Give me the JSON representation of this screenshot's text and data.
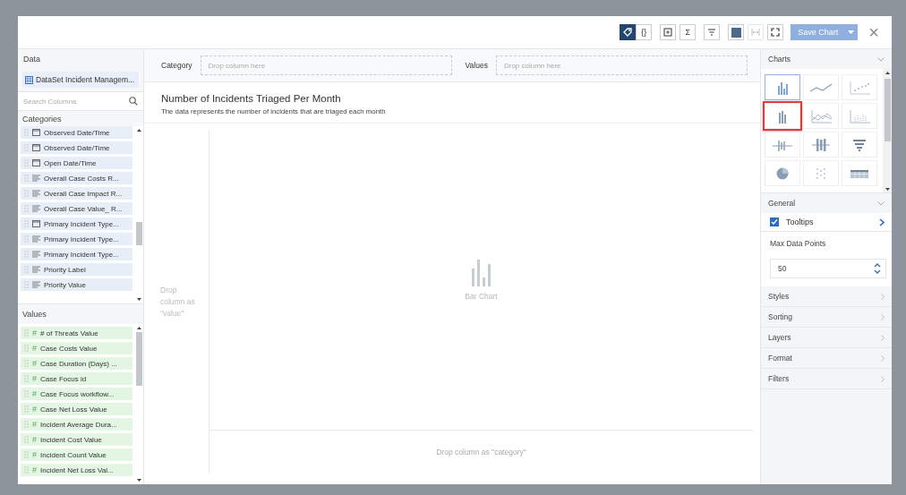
{
  "toolbar": {
    "buttons": [
      {
        "kind": "tag",
        "selected": true
      },
      {
        "kind": "braces",
        "label": "{}",
        "selected": false
      },
      {
        "kind": "frame",
        "selected": false
      },
      {
        "kind": "sigma",
        "label": "Σ",
        "selected": false
      },
      {
        "kind": "filter",
        "selected": false
      },
      {
        "kind": "swatch",
        "selected": false
      },
      {
        "kind": "width",
        "selected": false,
        "disabled": true
      },
      {
        "kind": "expand",
        "selected": false
      }
    ],
    "save": {
      "label": "Save Chart",
      "disabled": true
    },
    "close": "×"
  },
  "data_panel": {
    "title": "Data",
    "dataset": "DataSet Incident Managem...",
    "search": {
      "placeholder": "Search Columns"
    },
    "categories_title": "Categories",
    "categories": [
      {
        "kind": "date",
        "label": "Observed Date/Time"
      },
      {
        "kind": "date",
        "label": "Observed Date/Time"
      },
      {
        "kind": "date",
        "label": "Open Date/Time"
      },
      {
        "kind": "text",
        "label": "Overall Case Costs R..."
      },
      {
        "kind": "text",
        "label": "Overall Case Impact R..."
      },
      {
        "kind": "text",
        "label": "Overall Case Value_ R..."
      },
      {
        "kind": "date",
        "label": "Primary Incident Type..."
      },
      {
        "kind": "text",
        "label": "Primary Incident Type..."
      },
      {
        "kind": "text",
        "label": "Primary Incident Type..."
      },
      {
        "kind": "text",
        "label": "Priority Label"
      },
      {
        "kind": "text",
        "label": "Priority Value"
      }
    ],
    "values_title": "Values",
    "number_mark": "#",
    "values": [
      "# of Threats Value",
      "Case Costs Value",
      "Case Duration (Days) ...",
      "Case Focus id",
      "Case Focus workflow...",
      "Case Net Loss Value",
      "Incident Average Dura...",
      "Incident Cost Value",
      "Incident Count Value",
      "Incident Net Loss Val..."
    ]
  },
  "drop_bar": {
    "category_label": "Category",
    "category_placeholder": "Drop column here",
    "values_label": "Values",
    "values_placeholder": "Drop column here"
  },
  "chart": {
    "title": "Number of Incidents Triaged Per Month",
    "description": "The data represents the number of incidents that are triaged each month",
    "value_drop": "Drop column as \"value\"",
    "placeholder_label": "Bar Chart",
    "category_drop": "Drop column as \"category\""
  },
  "settings": {
    "charts_title": "Charts",
    "chart_types": [
      {
        "kind": "bar",
        "selected": true,
        "highlighted": false
      },
      {
        "kind": "line",
        "selected": false,
        "highlighted": false
      },
      {
        "kind": "scatter",
        "selected": false,
        "highlighted": false
      },
      {
        "kind": "grouped",
        "selected": false,
        "highlighted": true
      },
      {
        "kind": "area",
        "selected": false,
        "highlighted": false
      },
      {
        "kind": "dotbar",
        "selected": false,
        "highlighted": false
      },
      {
        "kind": "cross",
        "selected": false,
        "highlighted": false
      },
      {
        "kind": "box",
        "selected": false,
        "highlighted": false
      },
      {
        "kind": "funnel",
        "selected": false,
        "highlighted": false
      },
      {
        "kind": "pie",
        "selected": false,
        "highlighted": false
      },
      {
        "kind": "dots",
        "selected": false,
        "highlighted": false
      },
      {
        "kind": "table",
        "selected": false,
        "highlighted": false
      }
    ],
    "general_title": "General",
    "tooltips": {
      "label": "Tooltips",
      "checked": true
    },
    "max_points_label": "Max Data Points",
    "max_points": "50",
    "sections": [
      "Styles",
      "Sorting",
      "Layers",
      "Format",
      "Filters"
    ]
  }
}
